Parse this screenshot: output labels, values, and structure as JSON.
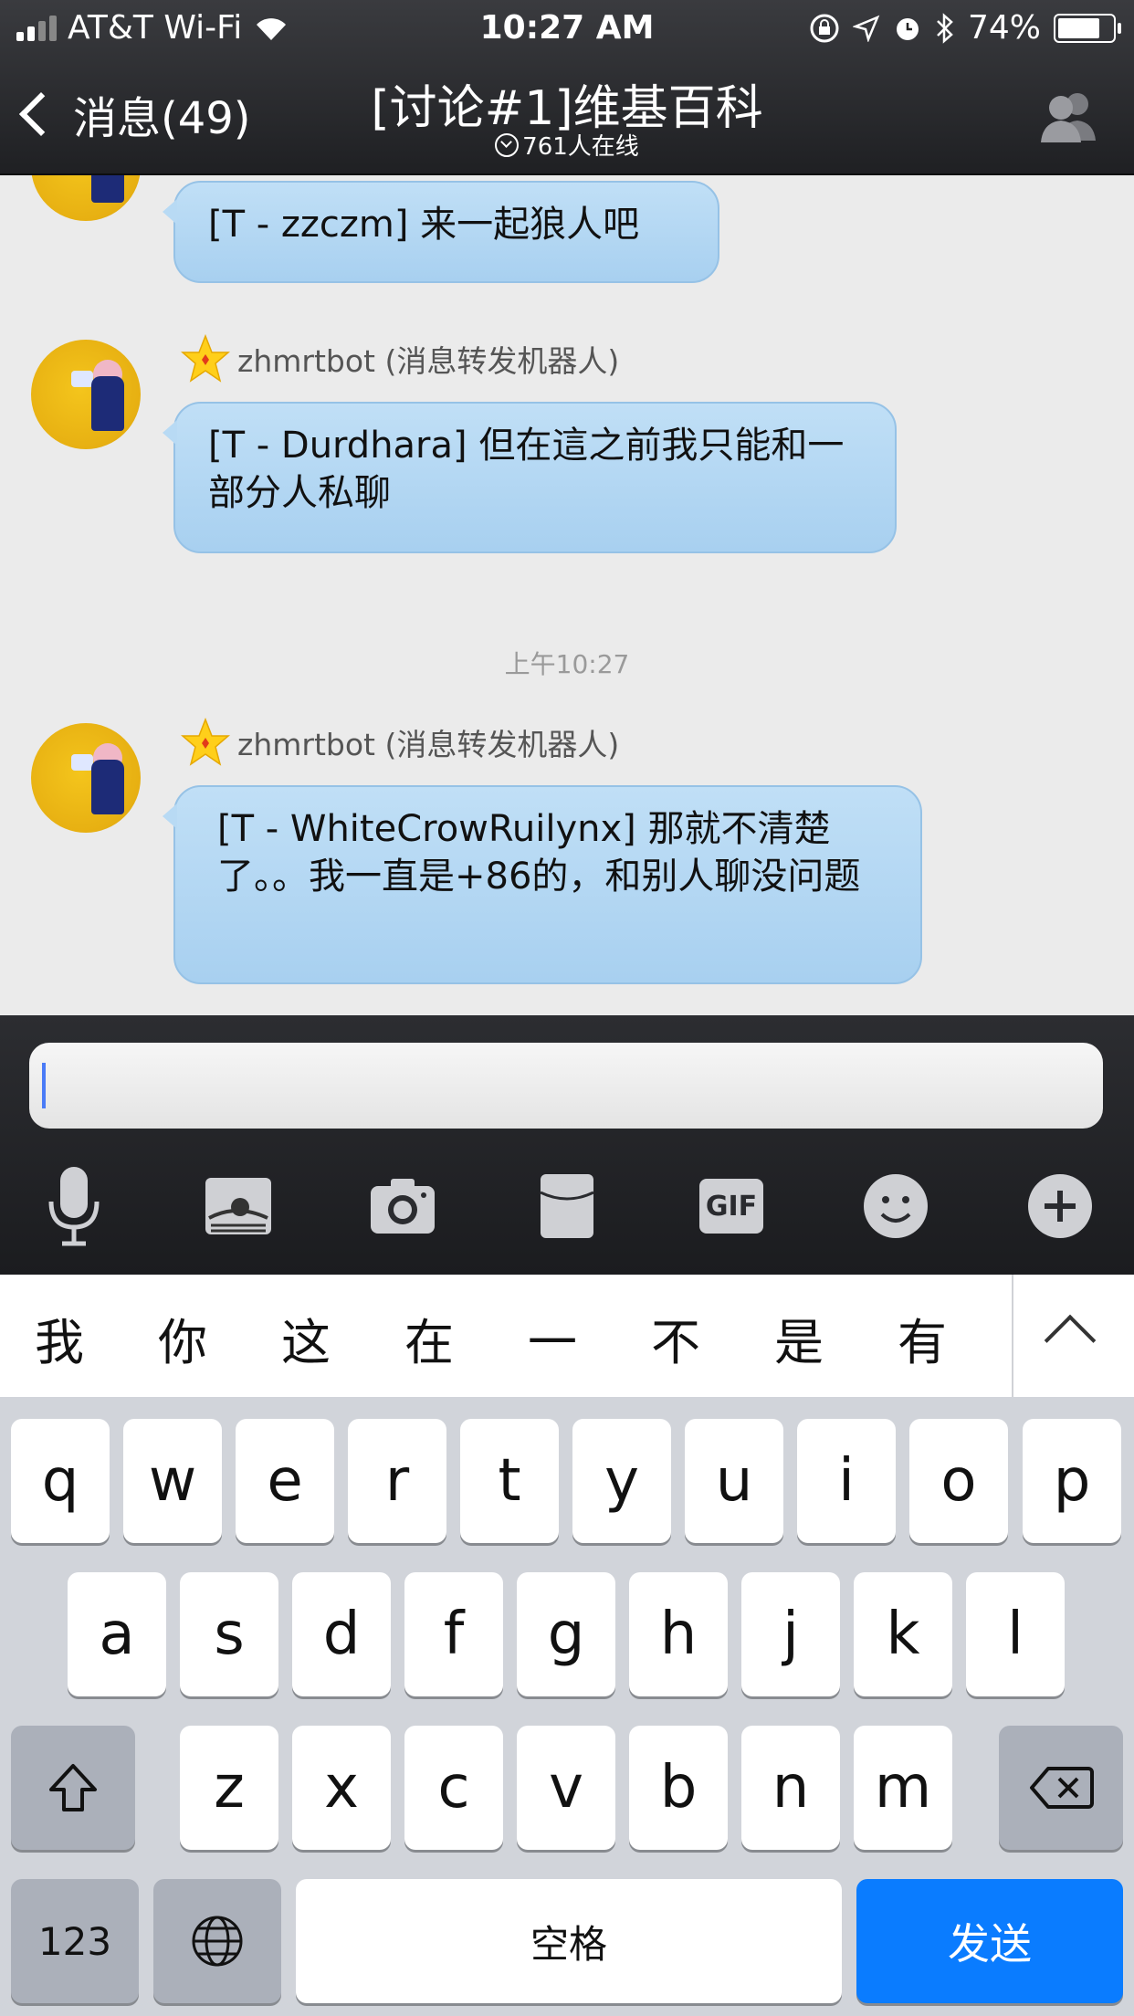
{
  "status_bar": {
    "carrier": "AT&T Wi-Fi",
    "time": "10:27 AM",
    "battery": "74%",
    "battery_level": 0.74
  },
  "nav": {
    "back_label": "消息(49)",
    "title": "[讨论#1]维基百科",
    "subtitle": "761人在线"
  },
  "messages": [
    {
      "sender": "",
      "text": "[T - zzczm] 来一起狼人吧"
    },
    {
      "sender": "zhmrtbot (消息转发机器人)",
      "text": "[T - Durdhara] 但在這之前我只能和一部分人私聊"
    },
    {
      "sender": "zhmrtbot (消息转发机器人)",
      "text": "[T - WhiteCrowRuilynx] 那就不清楚了。。我一直是+86的，和别人聊没问题"
    }
  ],
  "timestamp": "上午10:27",
  "input": {
    "value": ""
  },
  "toolbar": [
    "microphone-icon",
    "photo-icon",
    "camera-icon",
    "hongbao-icon",
    "gif-icon",
    "emoji-icon",
    "plus-icon"
  ],
  "toolbar_gif_label": "GIF",
  "keyboard": {
    "candidates": [
      "我",
      "你",
      "这",
      "在",
      "一",
      "不",
      "是",
      "有"
    ],
    "row1": [
      "q",
      "w",
      "e",
      "r",
      "t",
      "y",
      "u",
      "i",
      "o",
      "p"
    ],
    "row2": [
      "a",
      "s",
      "d",
      "f",
      "g",
      "h",
      "j",
      "k",
      "l"
    ],
    "row3": [
      "z",
      "x",
      "c",
      "v",
      "b",
      "n",
      "m"
    ],
    "numbers_label": "123",
    "space_label": "空格",
    "send_label": "发送"
  },
  "colors": {
    "bubble": "#b8daf4",
    "send_key": "#0a7cff",
    "chat_bg": "#ebebeb",
    "nav_bg": "#2a2b2f"
  }
}
